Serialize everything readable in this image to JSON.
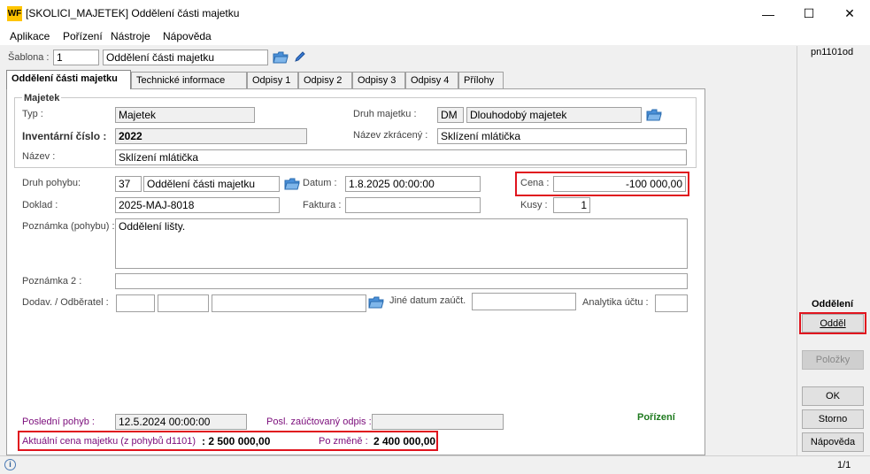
{
  "window": {
    "logo": "WF",
    "title": "[SKOLICI_MAJETEK] Oddělení části majetku",
    "minimize": "—",
    "maximize": "☐",
    "close": "✕"
  },
  "menu": [
    "Aplikace",
    "Pořízení",
    "Nástroje",
    "Nápověda"
  ],
  "sablona": {
    "label": "Šablona :",
    "code": "1",
    "name": "Oddělení části majetku"
  },
  "right_panel": {
    "code": "pn1101od",
    "section": "Oddělení",
    "oddel": "Odděl",
    "polozky": "Položky",
    "ok": "OK",
    "storno": "Storno",
    "napoveda": "Nápověda"
  },
  "tabs": [
    "Oddělení části majetku",
    "Technické informace",
    "Odpisy 1",
    "Odpisy 2",
    "Odpisy 3",
    "Odpisy 4",
    "Přílohy"
  ],
  "majetek": {
    "group_title": "Majetek",
    "typ_label": "Typ :",
    "typ_value": "Majetek",
    "druh_label": "Druh majetku :",
    "druh_code": "DM",
    "druh_value": "Dlouhodobý majetek",
    "inv_label": "Inventární číslo :",
    "inv_value": "2022",
    "nazev_zkr_label": "Název zkrácený :",
    "nazev_zkr_value": "Sklízení mlátička",
    "nazev_label": "Název :",
    "nazev_value": "Sklízení mlátička"
  },
  "pohyb": {
    "druh_label": "Druh pohybu:",
    "druh_code": "37",
    "druh_value": "Oddělení části majetku",
    "datum_label": "Datum :",
    "datum_value": "1.8.2025 00:00:00",
    "cena_label": "Cena :",
    "cena_value": "-100 000,00",
    "doklad_label": "Doklad :",
    "doklad_value": "2025-MAJ-8018",
    "faktura_label": "Faktura :",
    "faktura_value": "",
    "kusy_label": "Kusy :",
    "kusy_value": "1",
    "poznamka_label": "Poznámka (pohybu) :",
    "poznamka_value": "Oddělení lišty.",
    "poznamka2_label": "Poznámka 2 :",
    "poznamka2_value": "",
    "dodav_label": "Dodav. / Odběratel :",
    "jine_datum_label": "Jiné datum zaúčt.",
    "analytika_label": "Analytika účtu :"
  },
  "footer": {
    "posledni_label": "Poslední pohyb :",
    "posledni_value": "12.5.2024 00:00:00",
    "posl_odpis_label": "Posl. zaúčtovaný odpis :",
    "porizeni": "Pořízení",
    "aktualni_label": "Aktuální cena majetku  (z pohybů d1101)",
    "aktualni_value": ": 2 500 000,00",
    "po_zmene_label": "Po změně  :",
    "po_zmene_value": "2 400 000,00"
  },
  "status": {
    "info_icon": "i",
    "page": "1/1"
  },
  "colors": {
    "accent_red": "#e0141e",
    "purple": "#7b0c7b",
    "green": "#1e7a1e",
    "logo_yellow": "#ffc400"
  }
}
